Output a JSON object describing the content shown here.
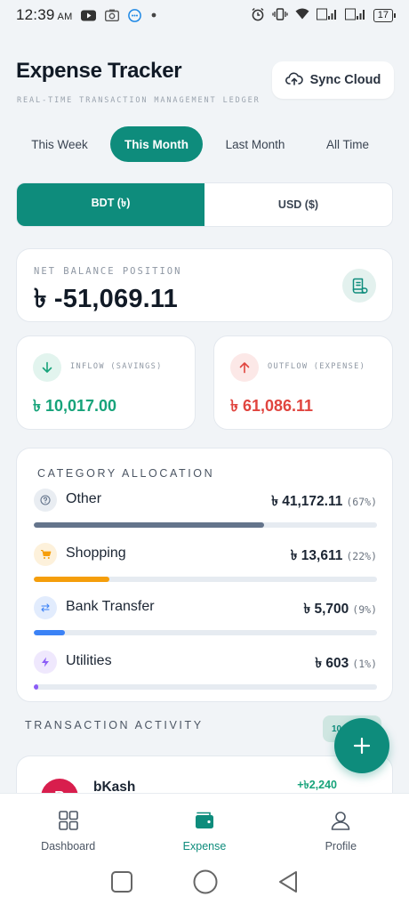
{
  "status_bar": {
    "time": "12:39",
    "ampm": "AM",
    "battery": "17"
  },
  "header": {
    "title": "Expense Tracker",
    "subtitle": "REAL-TIME TRANSACTION MANAGEMENT LEDGER",
    "sync_label": "Sync Cloud"
  },
  "period_tabs": [
    {
      "label": "This Week",
      "active": false
    },
    {
      "label": "This Month",
      "active": true
    },
    {
      "label": "Last Month",
      "active": false
    },
    {
      "label": "All Time",
      "active": false
    }
  ],
  "currency": {
    "options": [
      "BDT (৳)",
      "USD ($)"
    ],
    "selected": "BDT (৳)"
  },
  "balance": {
    "label": "NET BALANCE POSITION",
    "value": "৳ -51,069.11"
  },
  "inflow": {
    "label": "INFLOW (SAVINGS)",
    "value": "৳ 10,017.00",
    "color": "#17a37a"
  },
  "outflow": {
    "label": "OUTFLOW (EXPENSE)",
    "value": "৳ 61,086.11",
    "color": "#e0453f"
  },
  "categories": {
    "heading": "CATEGORY ALLOCATION",
    "items": [
      {
        "name": "Other",
        "amount": "৳ 41,172.11",
        "pct": "(67%)",
        "share": 0.67,
        "color": "#64748b",
        "icon": "question-icon"
      },
      {
        "name": "Shopping",
        "amount": "৳ 13,611",
        "pct": "(22%)",
        "share": 0.22,
        "color": "#f59e0b",
        "icon": "cart-icon"
      },
      {
        "name": "Bank Transfer",
        "amount": "৳ 5,700",
        "pct": "(9%)",
        "share": 0.09,
        "color": "#3b82f6",
        "icon": "transfer-icon"
      },
      {
        "name": "Utilities",
        "amount": "৳ 603",
        "pct": "(1%)",
        "share": 0.01,
        "color": "#8b5cf6",
        "icon": "bolt-icon"
      }
    ]
  },
  "activity": {
    "heading": "TRANSACTION ACTIVITY",
    "count_badge": "10",
    "transactions": [
      {
        "avatar": "B",
        "name": "bKash",
        "amount": "+৳2,240"
      }
    ]
  },
  "bottom_nav": [
    {
      "label": "Dashboard",
      "icon": "grid-icon",
      "active": false
    },
    {
      "label": "Expense",
      "icon": "wallet-icon",
      "active": true
    },
    {
      "label": "Profile",
      "icon": "user-icon",
      "active": false
    }
  ]
}
